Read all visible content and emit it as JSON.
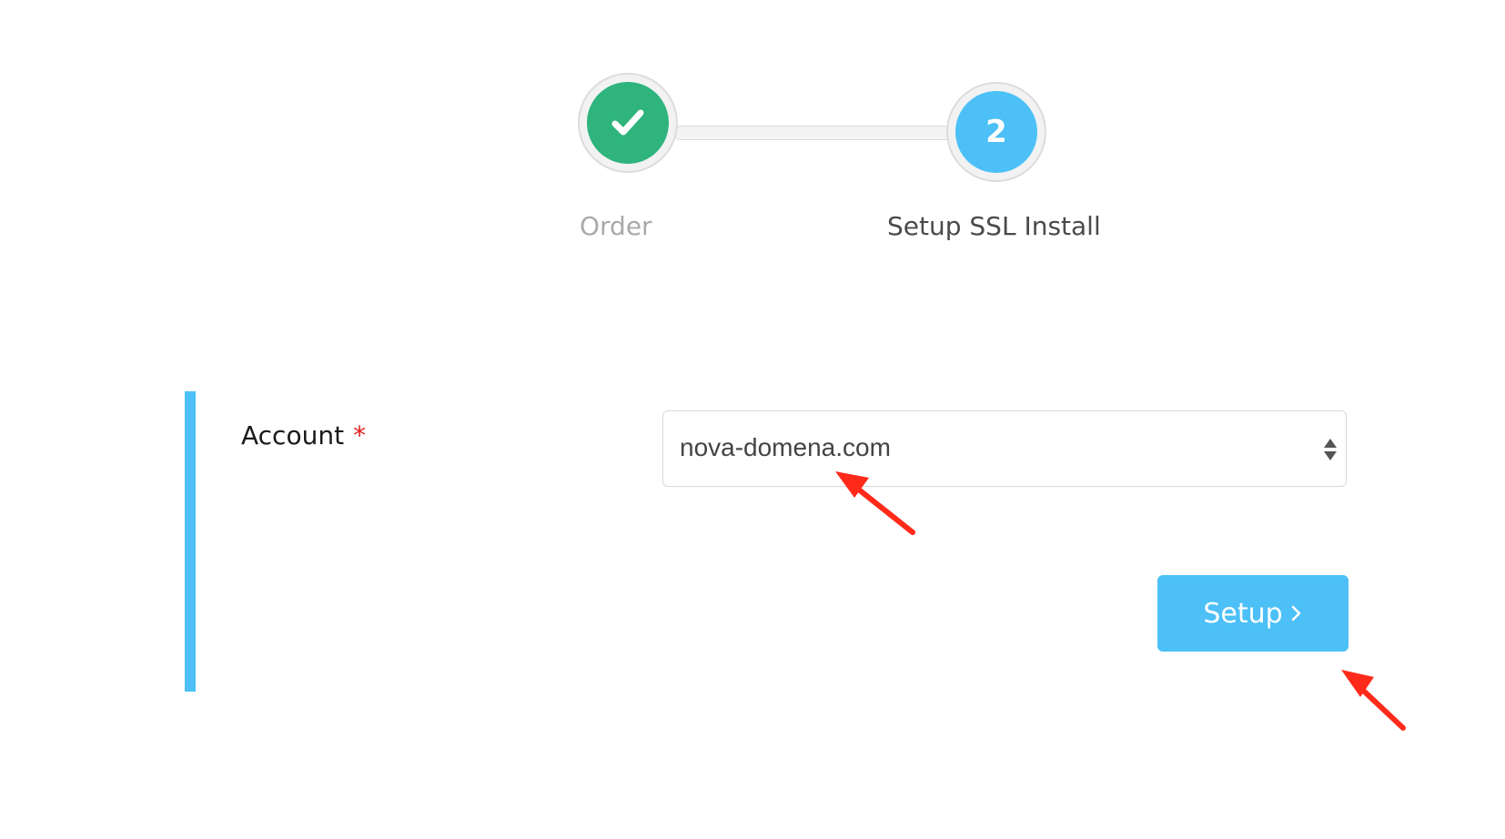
{
  "stepper": {
    "steps": [
      {
        "label": "Order",
        "status": "completed",
        "icon": "checkmark-icon"
      },
      {
        "label": "Setup SSL Install",
        "status": "current",
        "number": "2"
      }
    ]
  },
  "form": {
    "account_label": "Account",
    "required_mark": "*",
    "account_value": "nova-domena.com",
    "setup_label": "Setup"
  },
  "colors": {
    "completed": "#2eb47c",
    "accent": "#4cc0f7",
    "required": "#e02020",
    "annotation": "#ff2a1a"
  },
  "annotations": [
    {
      "type": "arrow",
      "points_to": "account-select"
    },
    {
      "type": "arrow",
      "points_to": "setup-button"
    }
  ]
}
